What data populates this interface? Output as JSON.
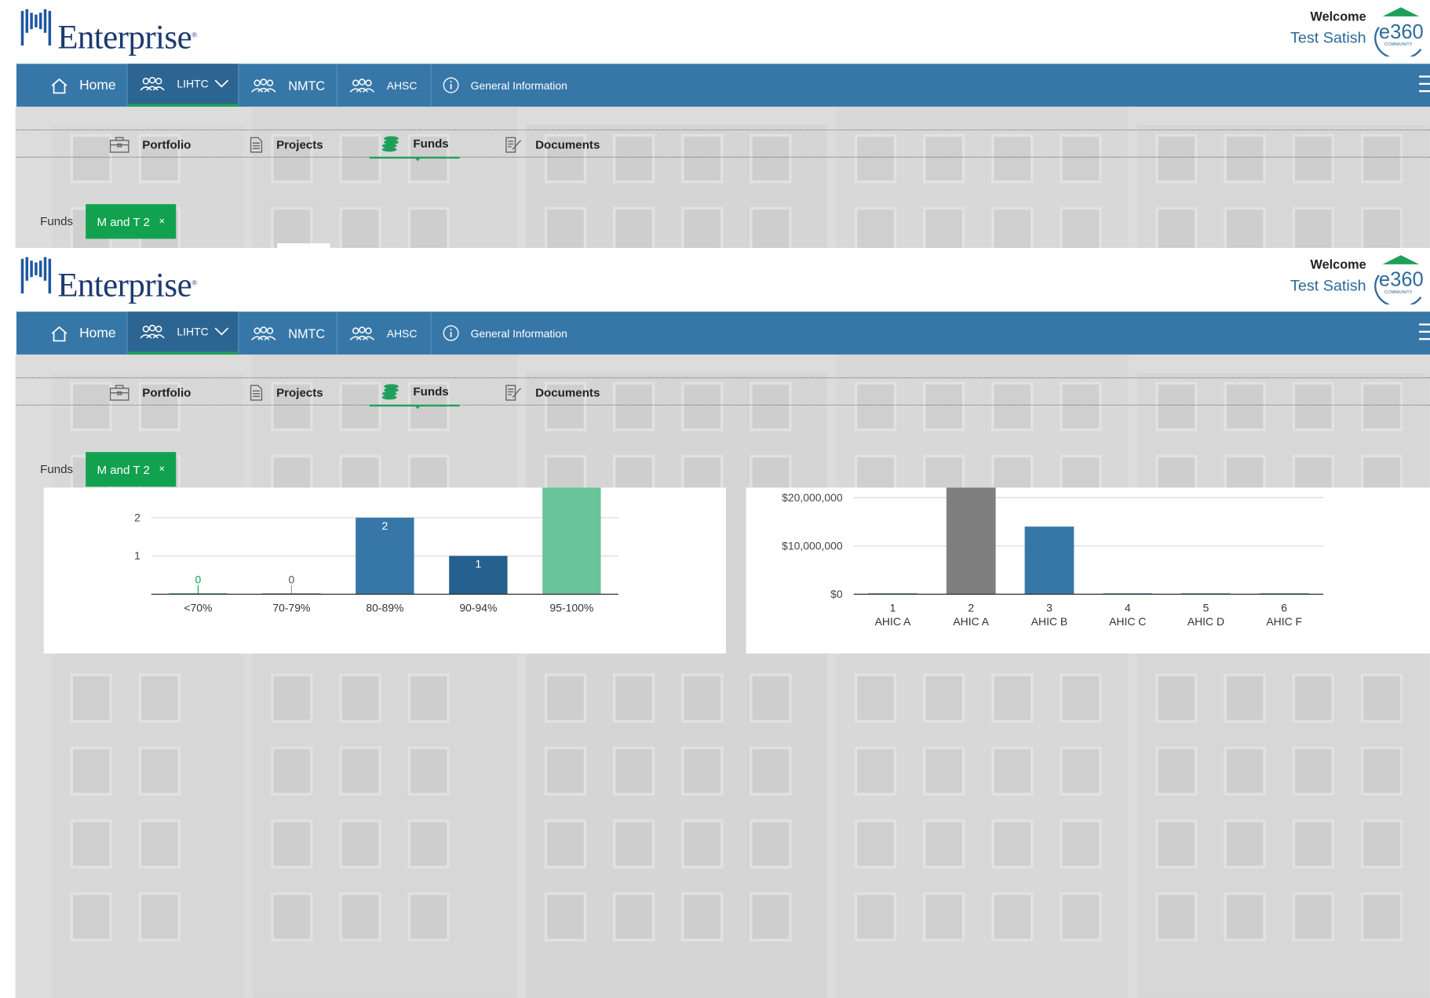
{
  "brand": {
    "name": "Enterprise",
    "reg": "®",
    "badge_text": "e360",
    "badge_sub": "COMMUNITY"
  },
  "user": {
    "welcome": "Welcome",
    "name": "Test Satish"
  },
  "nav": {
    "items": [
      {
        "label": "Home",
        "icon": "house-icon"
      },
      {
        "label": "LIHTC",
        "icon": "people-icon",
        "active": true
      },
      {
        "label": "NMTC",
        "icon": "people-icon"
      },
      {
        "label": "AHSC",
        "icon": "people-icon"
      },
      {
        "label": "General Information",
        "icon": "info-icon"
      }
    ]
  },
  "subnav": {
    "items": [
      {
        "label": "Portfolio",
        "icon": "briefcase-icon"
      },
      {
        "label": "Projects",
        "icon": "document-icon"
      },
      {
        "label": "Funds",
        "icon": "coins-icon",
        "active": true
      },
      {
        "label": "Documents",
        "icon": "edit-document-icon"
      }
    ]
  },
  "breadcrumb": {
    "label": "Funds",
    "fund_tag": "M and T 2",
    "close": "×"
  },
  "colors": {
    "nav": "#3777a8",
    "accent_green": "#12a24f",
    "bar_blue": "#3777a8",
    "bar_dark_blue": "#26608f",
    "bar_light_green": "#6ac499",
    "bar_gray": "#7f7f7f"
  },
  "chart_data": [
    {
      "type": "bar",
      "categories": [
        "<70%",
        "70-79%",
        "80-89%",
        "90-94%",
        "95-100%"
      ],
      "values": [
        0,
        0,
        2,
        1,
        3
      ],
      "data_labels": [
        "0",
        "0",
        "2",
        "1",
        ""
      ],
      "y_ticks": [
        "1",
        "2"
      ],
      "ylim": [
        0,
        2.6
      ],
      "colors": [
        "#12a24f",
        "#7f7f7f",
        "#3777a8",
        "#26608f",
        "#6ac499"
      ]
    },
    {
      "type": "bar",
      "categories": [
        "1",
        "2",
        "3",
        "4",
        "5",
        "6"
      ],
      "category_sublabels": [
        "AHIC A",
        "AHIC A",
        "AHIC B",
        "AHIC C",
        "AHIC D",
        "AHIC F"
      ],
      "values": [
        0,
        23000000,
        14000000,
        0,
        0,
        0
      ],
      "y_ticks": [
        "$0",
        "$10,000,000",
        "$20,000,000"
      ],
      "ylim": [
        0,
        20000000
      ],
      "colors": [
        "#3777a8",
        "#7f7f7f",
        "#3777a8",
        "#3777a8",
        "#3777a8",
        "#3777a8"
      ]
    }
  ]
}
